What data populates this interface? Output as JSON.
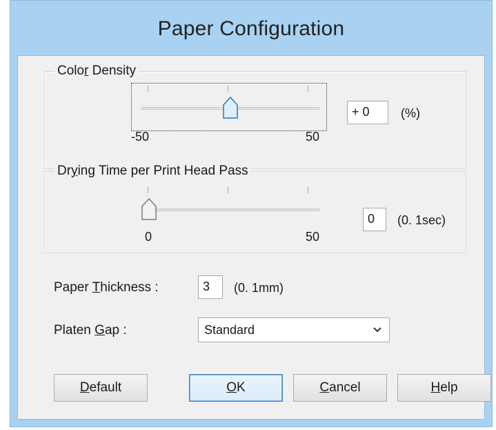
{
  "dialog": {
    "title": "Paper Configuration"
  },
  "color_density": {
    "label_pre": "Colo",
    "label_ul": "r",
    "label_post": " Density",
    "min_label": "-50",
    "max_label": "50",
    "value": "+ 0",
    "unit": "(%)",
    "slider_fraction": 0.5
  },
  "drying_time": {
    "label_pre": "Dr",
    "label_ul": "y",
    "label_post": "ing Time per Print Head Pass",
    "min_label": "0",
    "max_label": "50",
    "value": "0",
    "unit": "(0. 1sec)",
    "slider_fraction": 0.0
  },
  "paper_thickness": {
    "label_pre": "Paper ",
    "label_ul": "T",
    "label_post": "hickness :",
    "value": "3",
    "unit": "(0. 1mm)"
  },
  "platen_gap": {
    "label_pre": "Platen ",
    "label_ul": "G",
    "label_post": "ap :",
    "selected": "Standard"
  },
  "buttons": {
    "default": {
      "ul": "D",
      "rest": "efault"
    },
    "ok": {
      "ul": "O",
      "rest": "K"
    },
    "cancel": {
      "ul": "C",
      "rest": "ancel"
    },
    "help": {
      "ul": "H",
      "rest": "elp"
    }
  },
  "colors": {
    "title_bar": "#a9d1f1",
    "client_bg": "#f0f0f0",
    "primary_border": "#3c7fb1"
  }
}
